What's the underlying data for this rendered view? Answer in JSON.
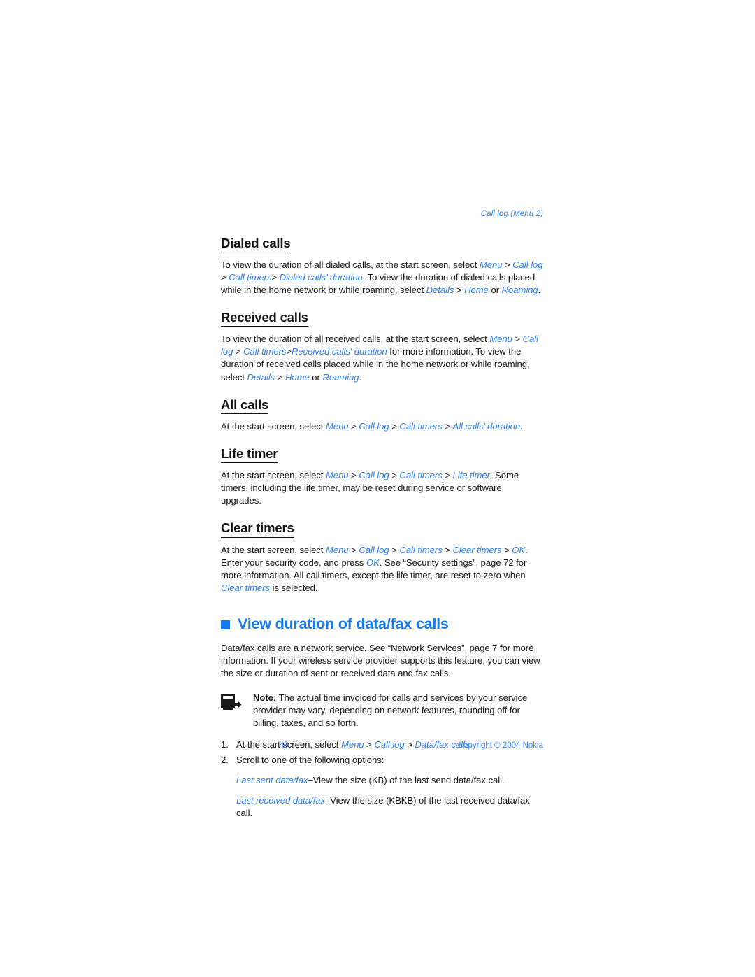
{
  "colors": {
    "accent_blue": "#2f80f5",
    "heading_blue": "#1579f2",
    "body_black": "#151515"
  },
  "running_header": "Call log (Menu 2)",
  "sections": [
    {
      "heading": "Dialed calls",
      "paragraphs": [
        "To view the duration of all dialed calls, at the start screen, select Menu > Call log > Call timers > Dialed calls' duration. To view the duration of dialed calls placed while in the home network or while roaming, select Details > Home or Roaming."
      ]
    },
    {
      "heading": "Received calls",
      "paragraphs": [
        "To view the duration of all received calls, at the start screen, select Menu > Call log > Call timers > Received calls' duration for more information. To view the duration of received calls placed while in the home network or while roaming, select Details > Home or Roaming."
      ]
    },
    {
      "heading": "All calls",
      "paragraphs": [
        "At the start screen, select Menu > Call log > Call timers > All calls' duration."
      ]
    },
    {
      "heading": "Life timer",
      "paragraphs": [
        "At the start screen, select Menu > Call log > Call timers > Life timer. Some timers, including the life timer, may be reset during service or software upgrades."
      ]
    },
    {
      "heading": "Clear timers",
      "paragraphs": [
        "At the start screen, select Menu > Call log > Call timers > Clear timers > OK. Enter your security code, and press OK. See “Security settings”, page 72 for more information. All call timers, except the life timer, are reset to zero when Clear timers is selected."
      ]
    }
  ],
  "main_section": {
    "heading": "View duration of data/fax calls",
    "intro": "Data/fax calls are a network service. See “Network Services”, page 7 for more information. If your wireless service provider supports this feature, you can view the size or duration of sent or received data and fax calls.",
    "note": {
      "label": "Note:",
      "text": " The actual time invoiced for calls and services by your service provider may vary, depending on network features, rounding off for billing, taxes, and so forth."
    },
    "steps": [
      {
        "num": "1.",
        "text": "At the start screen, select Menu > Call log > Data/fax calls."
      },
      {
        "num": "2.",
        "text": "Scroll to one of the following options:"
      }
    ],
    "options": [
      {
        "term": "Last sent data/fax",
        "desc": "–View the size (KB) of the last send data/fax call."
      },
      {
        "term": "Last received data/fax",
        "desc": "–View the size (KBKB) of the last received data/fax call."
      }
    ]
  },
  "footer": {
    "page_number": "43",
    "copyright": "Copyright © 2004 Nokia"
  }
}
